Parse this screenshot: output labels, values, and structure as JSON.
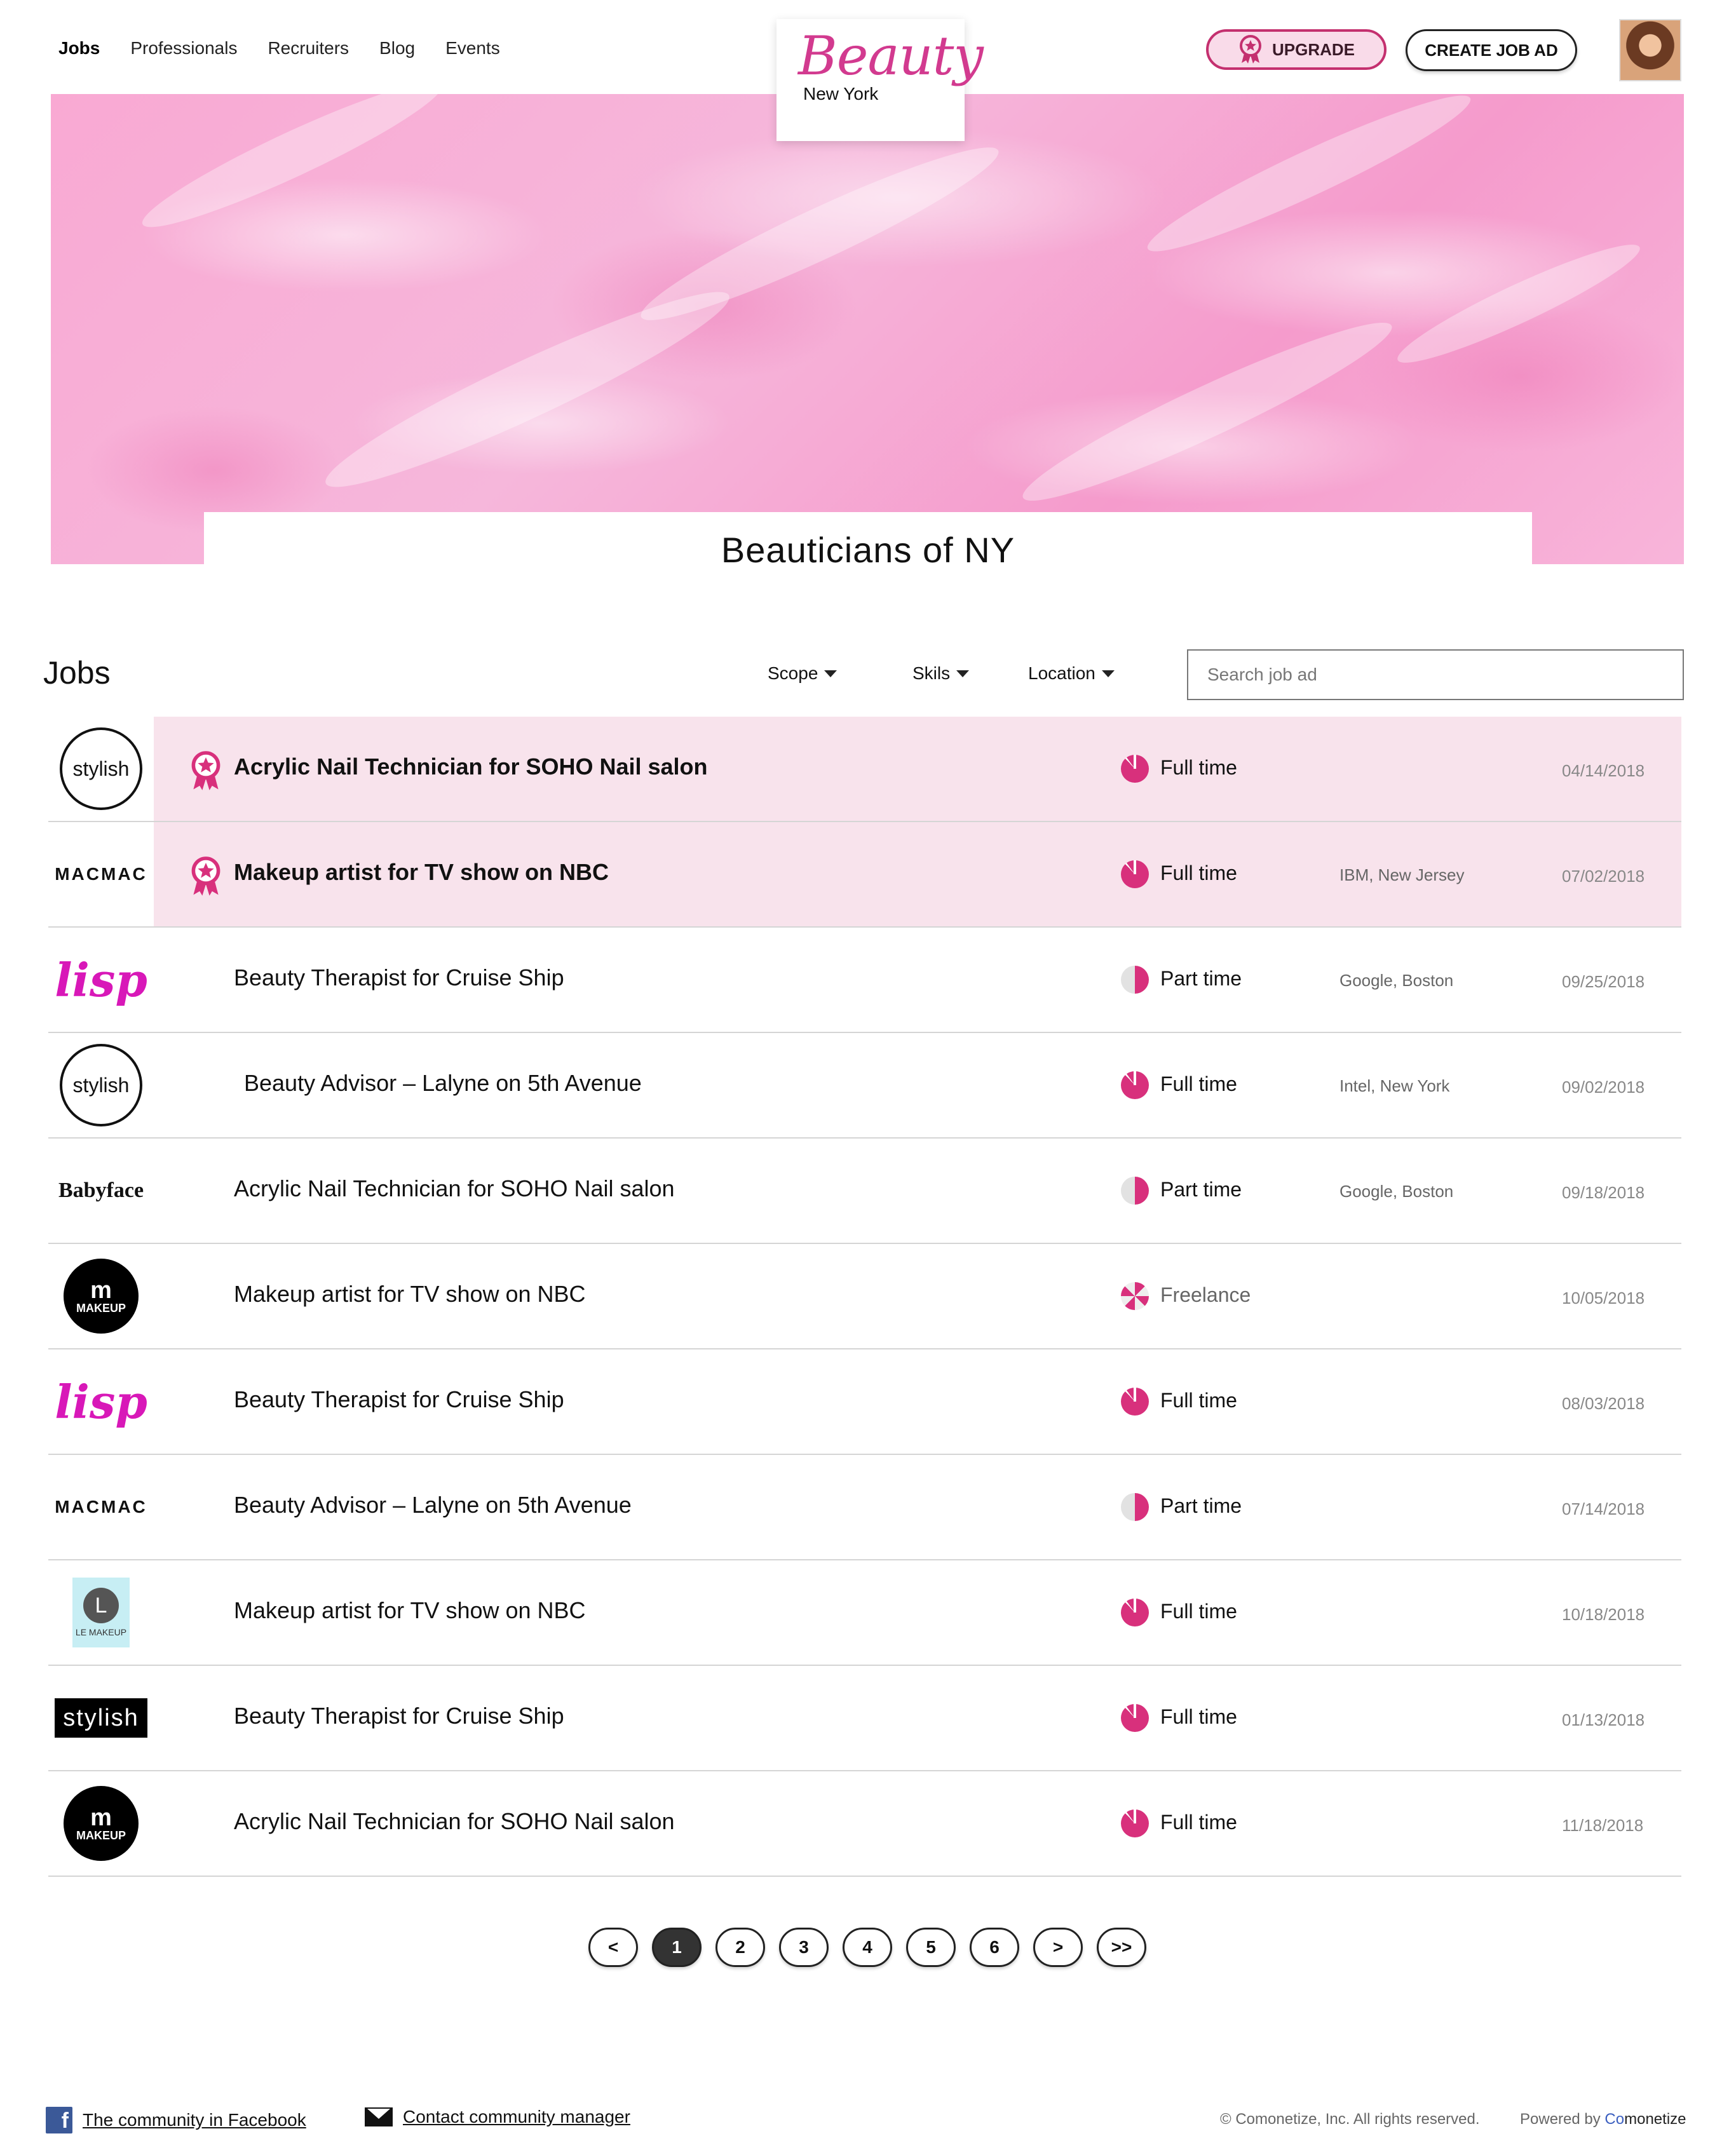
{
  "nav": {
    "items": [
      {
        "label": "Jobs",
        "active": true
      },
      {
        "label": "Professionals"
      },
      {
        "label": "Recruiters"
      },
      {
        "label": "Blog"
      },
      {
        "label": "Events"
      }
    ]
  },
  "logo": {
    "brand": "Beauty",
    "city": "New York"
  },
  "header": {
    "upgrade_label": "UPGRADE",
    "create_label": "CREATE JOB AD"
  },
  "hero": {
    "title": "Beauticians of NY"
  },
  "jobs": {
    "heading": "Jobs",
    "filters": {
      "scope": "Scope",
      "skills": "Skils",
      "location": "Location"
    },
    "search_placeholder": "Search job ad",
    "rows": [
      {
        "company_logo": "stylish",
        "logo_style": "circle",
        "title": "Acrylic Nail Technician for SOHO Nail salon",
        "featured": true,
        "scope": "Full time",
        "scope_type": "full",
        "company": "",
        "date": "04/14/2018"
      },
      {
        "company_logo": "MACMAC",
        "logo_style": "macmac",
        "title": "Makeup artist for TV show on NBC",
        "featured": true,
        "scope": "Full time",
        "scope_type": "full",
        "company": "IBM,  New Jersey",
        "date": "07/02/2018"
      },
      {
        "company_logo": "lisp",
        "logo_style": "lisp",
        "title": "Beauty Therapist for Cruise Ship",
        "featured": false,
        "scope": "Part time",
        "scope_type": "part",
        "company": "Google,  Boston",
        "date": "09/25/2018"
      },
      {
        "company_logo": "stylish",
        "logo_style": "circle",
        "title": "Beauty Advisor – Lalyne on 5th Avenue",
        "featured": false,
        "scope": "Full time",
        "scope_type": "full",
        "company": "Intel,  New York",
        "date": "09/02/2018"
      },
      {
        "company_logo": "Babyface",
        "logo_style": "babyface",
        "title": "Acrylic Nail Technician for SOHO Nail salon",
        "featured": false,
        "scope": "Part time",
        "scope_type": "part",
        "company": "Google,  Boston",
        "date": "09/18/2018"
      },
      {
        "company_logo": "m MAKEUP",
        "logo_style": "m",
        "title": "Makeup artist for TV show on NBC",
        "featured": false,
        "scope": "Freelance",
        "scope_type": "free",
        "company": "",
        "date": "10/05/2018"
      },
      {
        "company_logo": "lisp",
        "logo_style": "lisp",
        "title": "Beauty Therapist for Cruise Ship",
        "featured": false,
        "scope": "Full time",
        "scope_type": "full",
        "company": "",
        "date": "08/03/2018"
      },
      {
        "company_logo": "MACMAC",
        "logo_style": "macmac",
        "title": "Beauty Advisor – Lalyne on 5th Avenue",
        "featured": false,
        "scope": "Part time",
        "scope_type": "part",
        "company": "",
        "date": "07/14/2018"
      },
      {
        "company_logo": "LE MAKEUP",
        "logo_style": "le",
        "title": "Makeup artist for TV show on NBC",
        "featured": false,
        "scope": "Full time",
        "scope_type": "full",
        "company": "",
        "date": "10/18/2018"
      },
      {
        "company_logo": "stylish",
        "logo_style": "stylishbox",
        "title": "Beauty Therapist for Cruise Ship",
        "featured": false,
        "scope": "Full time",
        "scope_type": "full",
        "company": "",
        "date": "01/13/2018"
      },
      {
        "company_logo": "m MAKEUP",
        "logo_style": "m",
        "title": "Acrylic Nail Technician for SOHO Nail salon",
        "featured": false,
        "scope": "Full time",
        "scope_type": "full",
        "company": "",
        "date": "11/18/2018"
      }
    ]
  },
  "pagination": {
    "pages": [
      "<",
      "1",
      "2",
      "3",
      "4",
      "5",
      "6",
      ">",
      ">>"
    ],
    "current": "1"
  },
  "footer": {
    "facebook_label": "The community in Facebook",
    "contact_label": "Contact  community manager",
    "copyright": "© Comonetize, Inc. All rights reserved.",
    "powered_by": "Powered by",
    "powered_brand_first": "Co",
    "powered_brand_rest": "monetize"
  },
  "colors": {
    "accent": "#d8307c",
    "featured_bg": "#f8e3ec",
    "hero_pink": "#f6b7db"
  }
}
